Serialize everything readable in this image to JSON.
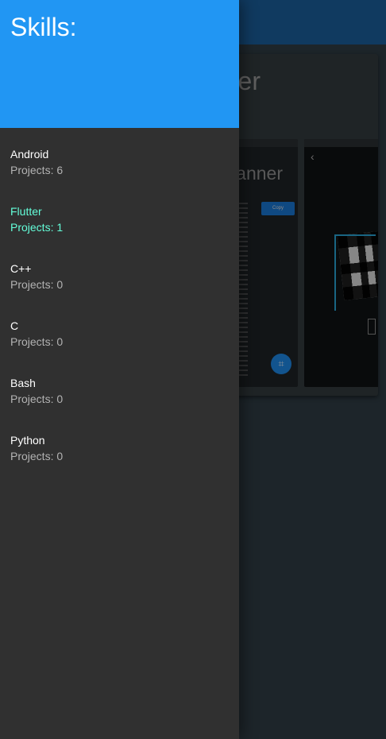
{
  "drawer": {
    "title": "Skills:",
    "header_color": "#2196f3",
    "selected_color": "#64ffda",
    "items": [
      {
        "name": "Android",
        "projects": "Projects: 6",
        "selected": false
      },
      {
        "name": "Flutter",
        "projects": "Projects: 1",
        "selected": true
      },
      {
        "name": "C++",
        "projects": "Projects: 0",
        "selected": false
      },
      {
        "name": "C",
        "projects": "Projects: 0",
        "selected": false
      },
      {
        "name": "Bash",
        "projects": "Projects: 0",
        "selected": false
      },
      {
        "name": "Python",
        "projects": "Projects: 0",
        "selected": false
      }
    ]
  },
  "background": {
    "card_title_fragment": "er",
    "screenshot_title_fragment": "anner",
    "copy_label": "Copy"
  }
}
